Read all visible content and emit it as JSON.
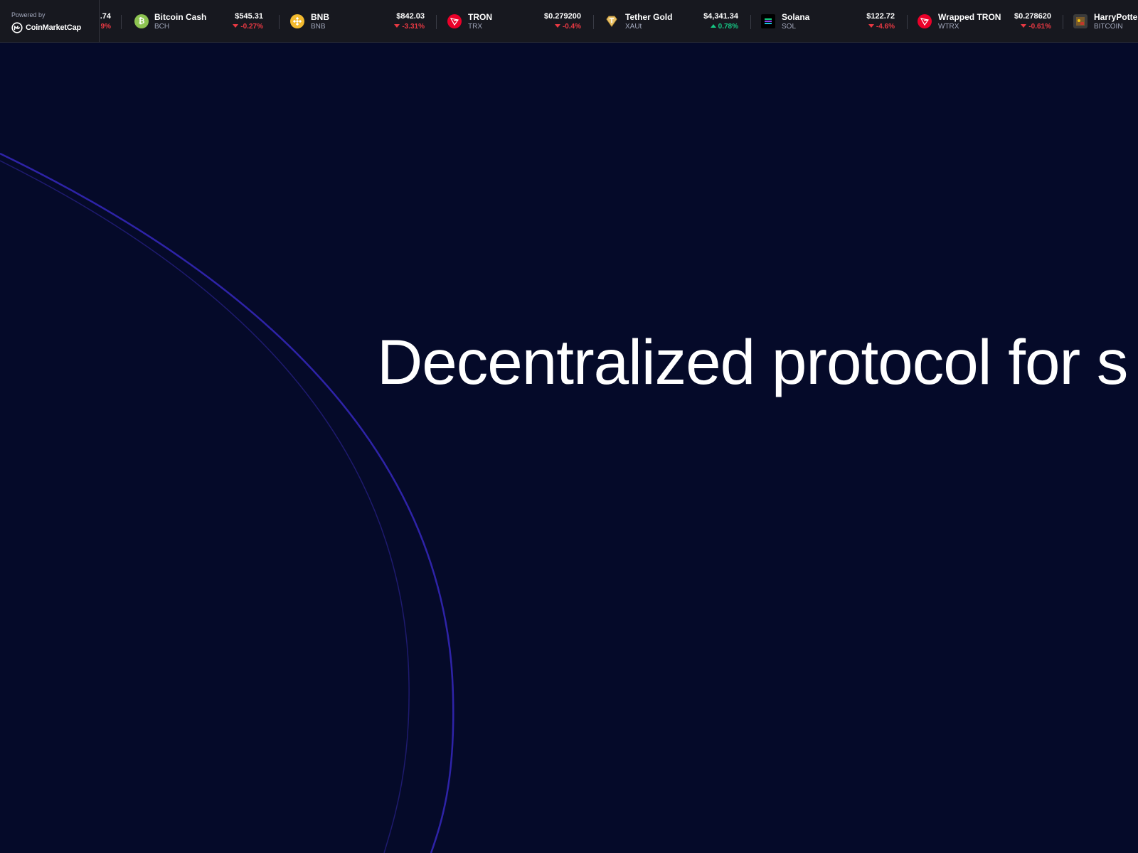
{
  "ticker": {
    "powered_label": "Powered by",
    "brand": "CoinMarketCap",
    "partial_first": {
      "price": ".74",
      "change": "9%"
    },
    "coins": [
      {
        "name": "Bitcoin Cash",
        "symbol": "BCH",
        "price": "$545.31",
        "change": "-0.27%",
        "direction": "down",
        "icon": "bitcoin-cash-icon",
        "color": "#8dc351"
      },
      {
        "name": "BNB",
        "symbol": "BNB",
        "price": "$842.03",
        "change": "-3.31%",
        "direction": "down",
        "icon": "bnb-icon",
        "color": "#f3ba2f"
      },
      {
        "name": "TRON",
        "symbol": "TRX",
        "price": "$0.279200",
        "change": "-0.4%",
        "direction": "down",
        "icon": "tron-icon",
        "color": "#eb0029"
      },
      {
        "name": "Tether Gold",
        "symbol": "XAUt",
        "price": "$4,341.34",
        "change": "0.78%",
        "direction": "up",
        "icon": "tether-gold-icon",
        "color": "#e8c26a"
      },
      {
        "name": "Solana",
        "symbol": "SOL",
        "price": "$122.72",
        "change": "-4.6%",
        "direction": "down",
        "icon": "solana-icon",
        "color": "#000000"
      },
      {
        "name": "Wrapped TRON",
        "symbol": "WTRX",
        "price": "$0.278620",
        "change": "-0.61%",
        "direction": "down",
        "icon": "wrapped-tron-icon",
        "color": "#eb0029"
      },
      {
        "name": "HarryPotter",
        "symbol": "BITCOIN",
        "price": "",
        "change": "",
        "direction": "",
        "icon": "harrypotter-icon",
        "color": "#3b3b3b"
      }
    ]
  },
  "hero": {
    "title": "Decentralized protocol for s"
  },
  "colors": {
    "background": "#050a29",
    "ticker_bg": "#17181f",
    "arc": "#2a1fa0",
    "down": "#ea3943",
    "up": "#16c784"
  }
}
